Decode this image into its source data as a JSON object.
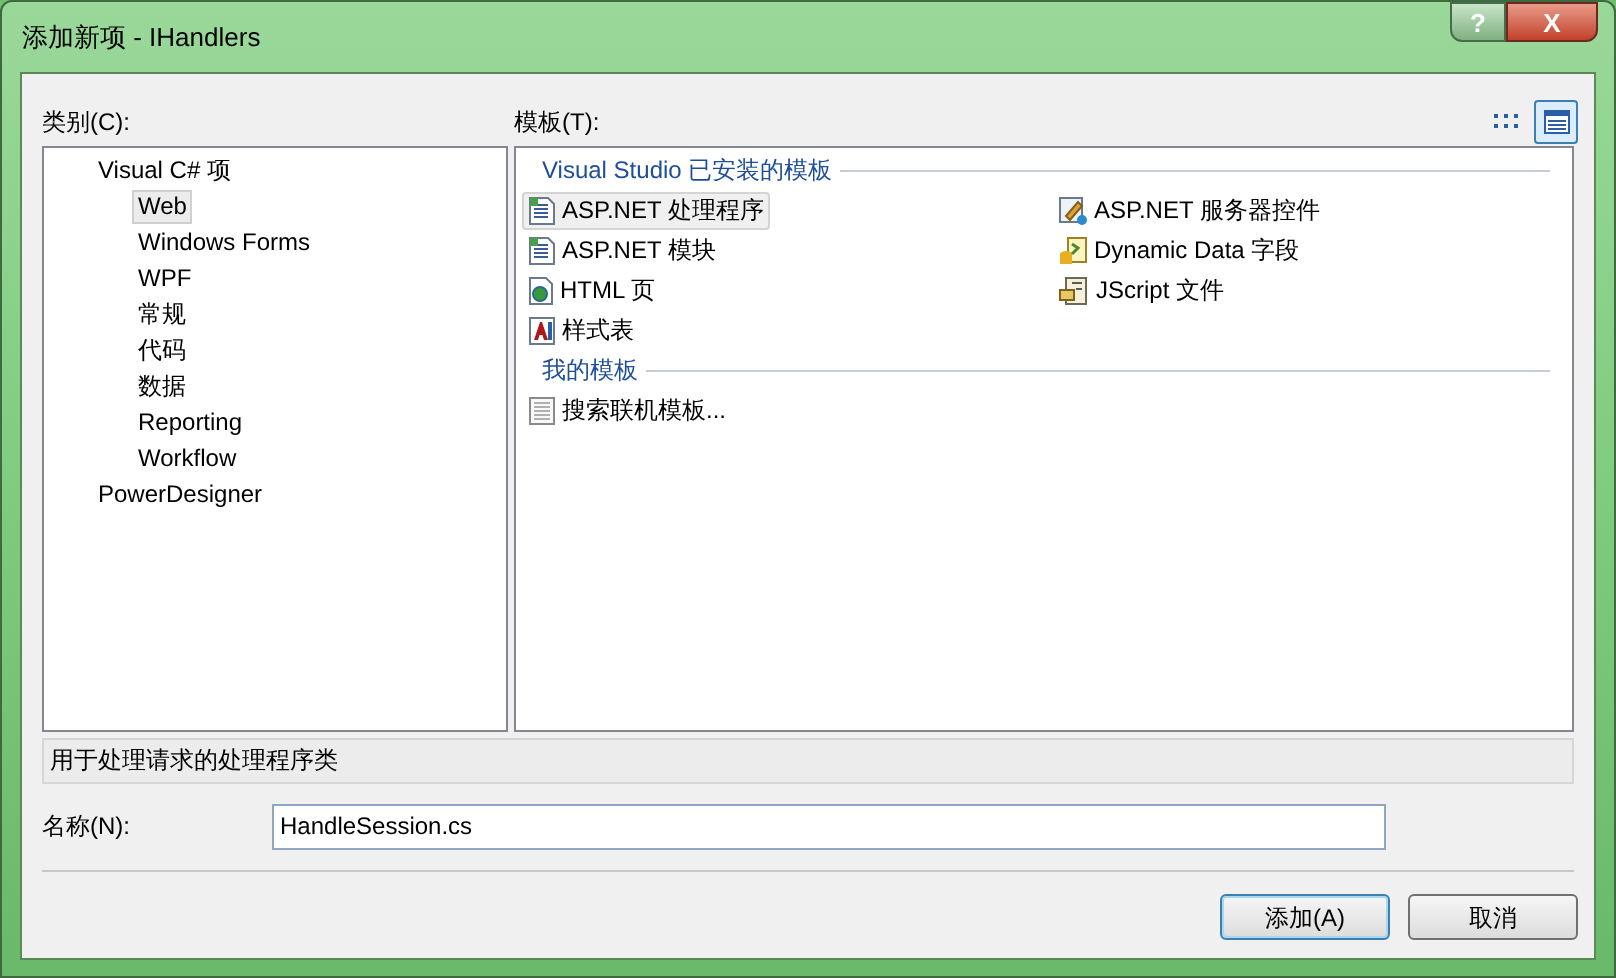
{
  "window": {
    "title": "添加新项 - IHandlers",
    "help": "?",
    "close": "X"
  },
  "categories": {
    "label": "类别(C):",
    "items": [
      {
        "label": "Visual C# 项",
        "selected": false,
        "children": [
          {
            "label": "Web",
            "selected": true
          },
          {
            "label": "Windows Forms",
            "selected": false
          },
          {
            "label": "WPF",
            "selected": false
          },
          {
            "label": "常规",
            "selected": false
          },
          {
            "label": "代码",
            "selected": false
          },
          {
            "label": "数据",
            "selected": false
          },
          {
            "label": "Reporting",
            "selected": false
          },
          {
            "label": "Workflow",
            "selected": false
          }
        ]
      },
      {
        "label": "PowerDesigner",
        "selected": false
      }
    ]
  },
  "templates": {
    "label": "模板(T):",
    "views": [
      {
        "kind": "small-icons",
        "selected": false
      },
      {
        "kind": "list",
        "selected": true
      }
    ],
    "sections": [
      {
        "title": "Visual Studio 已安装的模板",
        "items": [
          {
            "label": "ASP.NET 处理程序",
            "kind": "code-file",
            "selected": true
          },
          {
            "label": "ASP.NET 服务器控件",
            "kind": "control",
            "selected": false
          },
          {
            "label": "ASP.NET 模块",
            "kind": "code-file",
            "selected": false
          },
          {
            "label": "Dynamic Data 字段",
            "kind": "data",
            "selected": false
          },
          {
            "label": "HTML 页",
            "kind": "html",
            "selected": false
          },
          {
            "label": "JScript 文件",
            "kind": "script",
            "selected": false
          },
          {
            "label": "样式表",
            "kind": "stylesheet",
            "selected": false
          }
        ]
      },
      {
        "title": "我的模板",
        "items": [
          {
            "label": "搜索联机模板...",
            "kind": "online",
            "selected": false
          }
        ]
      }
    ]
  },
  "description": "用于处理请求的处理程序类",
  "name_field": {
    "label": "名称(N):",
    "value": "HandleSession.cs"
  },
  "buttons": [
    {
      "label": "添加(A)",
      "default": true
    },
    {
      "label": "取消",
      "default": false
    }
  ]
}
